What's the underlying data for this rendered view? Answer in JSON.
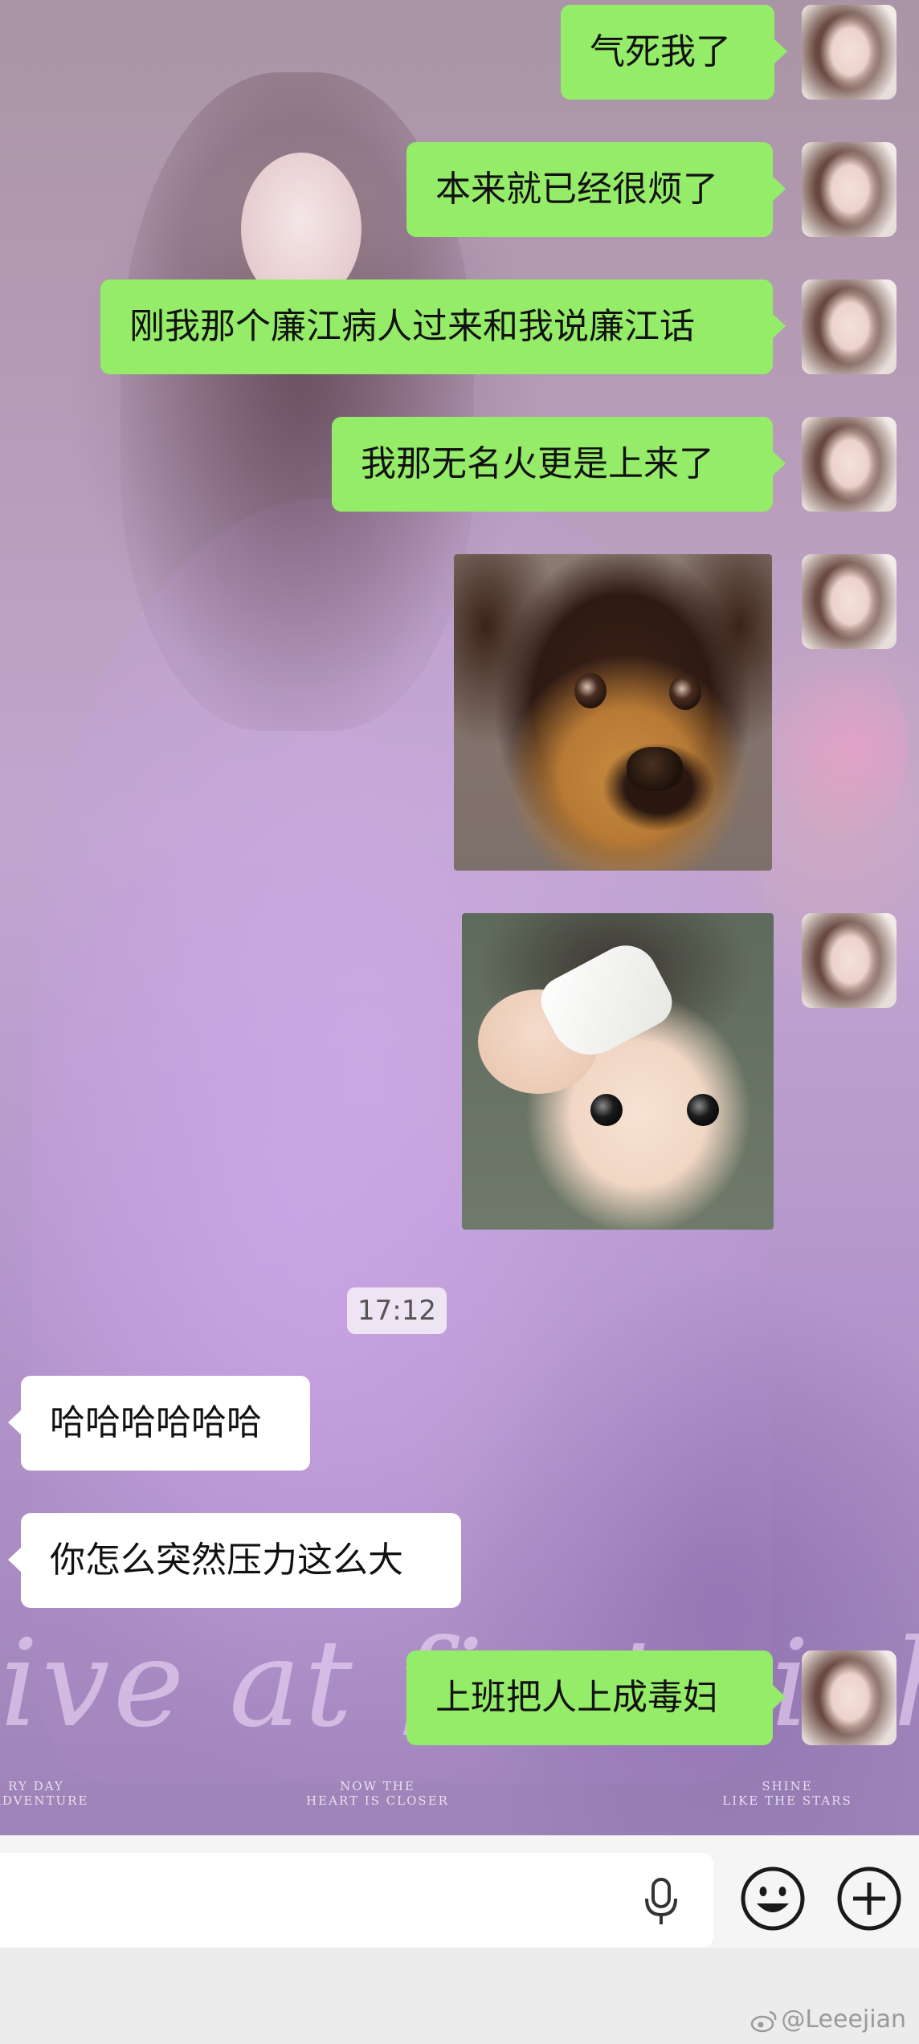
{
  "chat": {
    "messages": [
      {
        "from": "me",
        "type": "text",
        "text": "气死我了"
      },
      {
        "from": "me",
        "type": "text",
        "text": "本来就已经很烦了"
      },
      {
        "from": "me",
        "type": "text",
        "text": "刚我那个廉江病人过来和我说廉江话"
      },
      {
        "from": "me",
        "type": "text",
        "text": "我那无名火更是上来了"
      },
      {
        "from": "me",
        "type": "sticker",
        "sticker": "dog-sticker"
      },
      {
        "from": "me",
        "type": "sticker",
        "sticker": "baby-towel-sticker"
      },
      {
        "from": "system",
        "type": "timestamp",
        "text": "17:12"
      },
      {
        "from": "other",
        "type": "text",
        "text": "哈哈哈哈哈哈"
      },
      {
        "from": "other",
        "type": "text",
        "text": "你怎么突然压力这么大"
      },
      {
        "from": "me",
        "type": "text",
        "text": "上班把人上成毒妇"
      }
    ]
  },
  "wallpaper": {
    "script_text": "ive at first sigh",
    "captions": [
      "RY DAY\nADVENTURE",
      "NOW THE\nHEART IS CLOSER",
      "SHINE\nLIKE THE STARS"
    ]
  },
  "input_bar": {
    "icons": [
      "voice-mic-icon",
      "emoji-smiley-icon",
      "plus-icon"
    ]
  },
  "watermark": {
    "text": "@Leeejian",
    "icon": "weibo-logo-icon"
  },
  "colors": {
    "my_bubble": "#95ec69",
    "other_bubble": "#ffffff",
    "input_bar_bg": "#f5f5f5"
  }
}
